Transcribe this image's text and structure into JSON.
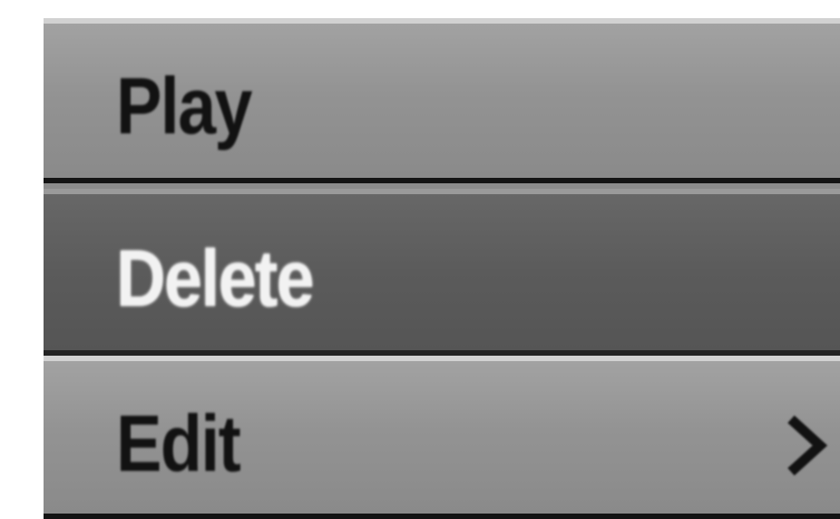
{
  "menu": {
    "items": [
      {
        "label": "Play",
        "selected": false
      },
      {
        "label": "Delete",
        "selected": true
      },
      {
        "label": "Edit",
        "selected": false,
        "has_submenu": true,
        "submenu_icon": "chevron-right-icon"
      }
    ]
  },
  "colors": {
    "item_background": "#939393",
    "selected_background": "#5b5b5b",
    "text": "#121212",
    "selected_text": "#f2f2f2"
  }
}
